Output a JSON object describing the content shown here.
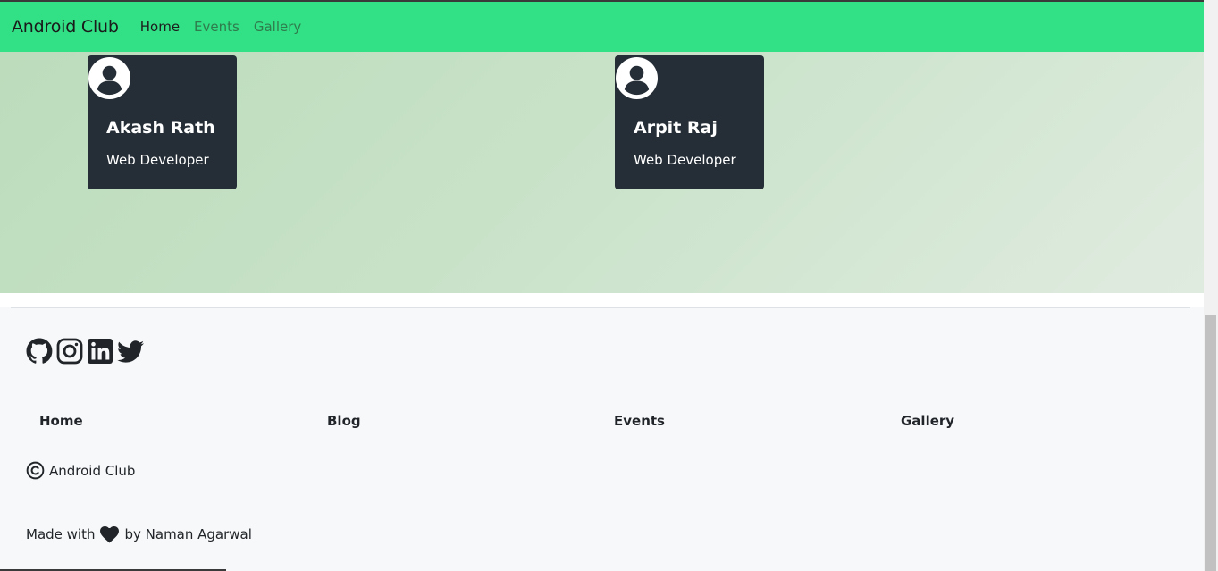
{
  "colors": {
    "navbar_bg": "#32e086",
    "card_bg": "#252e36",
    "footer_bg": "#f7f8f9",
    "hero_gradient_start": "#bcdcbc",
    "hero_gradient_end": "#e0ebe0"
  },
  "navbar": {
    "brand": "Android Club",
    "links": [
      {
        "label": "Home",
        "active": true
      },
      {
        "label": "Events",
        "active": false
      },
      {
        "label": "Gallery",
        "active": false
      }
    ]
  },
  "members": [
    {
      "name": "Akash Rath",
      "role": "Web Developer",
      "icon": "user-avatar-icon"
    },
    {
      "name": "Arpit Raj",
      "role": "Web Developer",
      "icon": "user-avatar-icon"
    }
  ],
  "footer": {
    "social_icons": [
      "github-icon",
      "instagram-icon",
      "linkedin-icon",
      "twitter-icon"
    ],
    "links": [
      "Home",
      "Blog",
      "Events",
      "Gallery"
    ],
    "copyright_text": "Android Club",
    "made_with_prefix": "Made with",
    "made_with_suffix": "by Naman Agarwal"
  }
}
